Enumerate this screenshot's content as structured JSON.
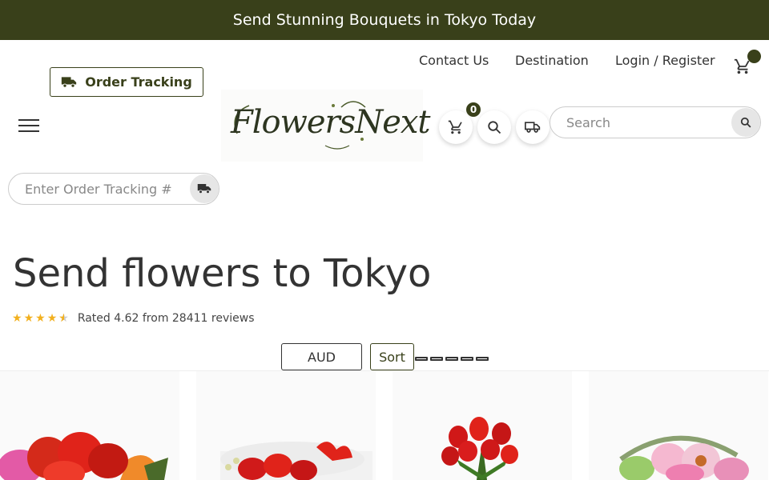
{
  "banner": {
    "text": "Send Stunning Bouquets in Tokyo Today"
  },
  "top_nav": {
    "links": [
      {
        "label": "Contact Us"
      },
      {
        "label": "Destination"
      },
      {
        "label": "Login / Register"
      }
    ],
    "cart_icon": "cart-icon"
  },
  "order_tracking_button": {
    "label": "Order Tracking",
    "icon": "truck-icon"
  },
  "logo": {
    "text": "FlowersNext"
  },
  "cart": {
    "count": "0",
    "icon": "cart-icon"
  },
  "search": {
    "placeholder": "Search",
    "icon": "search-icon"
  },
  "tracking_input": {
    "placeholder": "Enter Order Tracking #",
    "icon": "truck-icon"
  },
  "page": {
    "title": "Send flowers to Tokyo",
    "rating": {
      "stars": 4.62,
      "text": "Rated 4.62 from 28411 reviews"
    }
  },
  "toolbar": {
    "currency": "AUD",
    "sort_label": "Sort"
  },
  "colors": {
    "brand": "#39401a",
    "star": "#f2b01e"
  },
  "products": [
    {
      "image": "mixed-carnation-bouquet"
    },
    {
      "image": "red-rose-gift-box"
    },
    {
      "image": "red-roses-bouquet"
    },
    {
      "image": "pastel-gerbera-basket"
    }
  ]
}
